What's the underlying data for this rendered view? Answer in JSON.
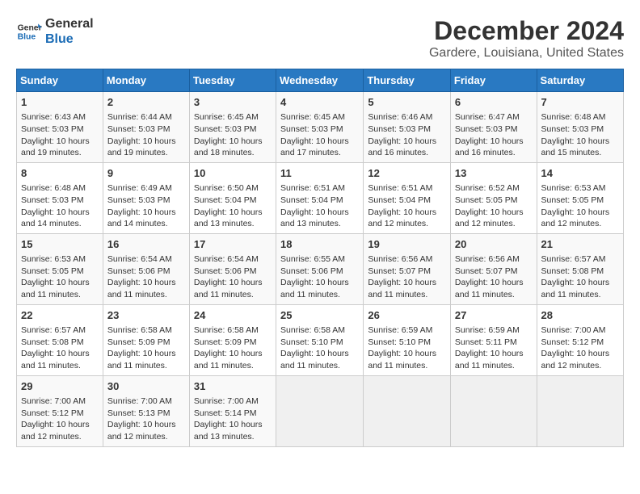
{
  "logo": {
    "line1": "General",
    "line2": "Blue"
  },
  "title": "December 2024",
  "subtitle": "Gardere, Louisiana, United States",
  "days_of_week": [
    "Sunday",
    "Monday",
    "Tuesday",
    "Wednesday",
    "Thursday",
    "Friday",
    "Saturday"
  ],
  "weeks": [
    [
      {
        "day": "1",
        "info": "Sunrise: 6:43 AM\nSunset: 5:03 PM\nDaylight: 10 hours\nand 19 minutes."
      },
      {
        "day": "2",
        "info": "Sunrise: 6:44 AM\nSunset: 5:03 PM\nDaylight: 10 hours\nand 19 minutes."
      },
      {
        "day": "3",
        "info": "Sunrise: 6:45 AM\nSunset: 5:03 PM\nDaylight: 10 hours\nand 18 minutes."
      },
      {
        "day": "4",
        "info": "Sunrise: 6:45 AM\nSunset: 5:03 PM\nDaylight: 10 hours\nand 17 minutes."
      },
      {
        "day": "5",
        "info": "Sunrise: 6:46 AM\nSunset: 5:03 PM\nDaylight: 10 hours\nand 16 minutes."
      },
      {
        "day": "6",
        "info": "Sunrise: 6:47 AM\nSunset: 5:03 PM\nDaylight: 10 hours\nand 16 minutes."
      },
      {
        "day": "7",
        "info": "Sunrise: 6:48 AM\nSunset: 5:03 PM\nDaylight: 10 hours\nand 15 minutes."
      }
    ],
    [
      {
        "day": "8",
        "info": "Sunrise: 6:48 AM\nSunset: 5:03 PM\nDaylight: 10 hours\nand 14 minutes."
      },
      {
        "day": "9",
        "info": "Sunrise: 6:49 AM\nSunset: 5:03 PM\nDaylight: 10 hours\nand 14 minutes."
      },
      {
        "day": "10",
        "info": "Sunrise: 6:50 AM\nSunset: 5:04 PM\nDaylight: 10 hours\nand 13 minutes."
      },
      {
        "day": "11",
        "info": "Sunrise: 6:51 AM\nSunset: 5:04 PM\nDaylight: 10 hours\nand 13 minutes."
      },
      {
        "day": "12",
        "info": "Sunrise: 6:51 AM\nSunset: 5:04 PM\nDaylight: 10 hours\nand 12 minutes."
      },
      {
        "day": "13",
        "info": "Sunrise: 6:52 AM\nSunset: 5:05 PM\nDaylight: 10 hours\nand 12 minutes."
      },
      {
        "day": "14",
        "info": "Sunrise: 6:53 AM\nSunset: 5:05 PM\nDaylight: 10 hours\nand 12 minutes."
      }
    ],
    [
      {
        "day": "15",
        "info": "Sunrise: 6:53 AM\nSunset: 5:05 PM\nDaylight: 10 hours\nand 11 minutes."
      },
      {
        "day": "16",
        "info": "Sunrise: 6:54 AM\nSunset: 5:06 PM\nDaylight: 10 hours\nand 11 minutes."
      },
      {
        "day": "17",
        "info": "Sunrise: 6:54 AM\nSunset: 5:06 PM\nDaylight: 10 hours\nand 11 minutes."
      },
      {
        "day": "18",
        "info": "Sunrise: 6:55 AM\nSunset: 5:06 PM\nDaylight: 10 hours\nand 11 minutes."
      },
      {
        "day": "19",
        "info": "Sunrise: 6:56 AM\nSunset: 5:07 PM\nDaylight: 10 hours\nand 11 minutes."
      },
      {
        "day": "20",
        "info": "Sunrise: 6:56 AM\nSunset: 5:07 PM\nDaylight: 10 hours\nand 11 minutes."
      },
      {
        "day": "21",
        "info": "Sunrise: 6:57 AM\nSunset: 5:08 PM\nDaylight: 10 hours\nand 11 minutes."
      }
    ],
    [
      {
        "day": "22",
        "info": "Sunrise: 6:57 AM\nSunset: 5:08 PM\nDaylight: 10 hours\nand 11 minutes."
      },
      {
        "day": "23",
        "info": "Sunrise: 6:58 AM\nSunset: 5:09 PM\nDaylight: 10 hours\nand 11 minutes."
      },
      {
        "day": "24",
        "info": "Sunrise: 6:58 AM\nSunset: 5:09 PM\nDaylight: 10 hours\nand 11 minutes."
      },
      {
        "day": "25",
        "info": "Sunrise: 6:58 AM\nSunset: 5:10 PM\nDaylight: 10 hours\nand 11 minutes."
      },
      {
        "day": "26",
        "info": "Sunrise: 6:59 AM\nSunset: 5:10 PM\nDaylight: 10 hours\nand 11 minutes."
      },
      {
        "day": "27",
        "info": "Sunrise: 6:59 AM\nSunset: 5:11 PM\nDaylight: 10 hours\nand 11 minutes."
      },
      {
        "day": "28",
        "info": "Sunrise: 7:00 AM\nSunset: 5:12 PM\nDaylight: 10 hours\nand 12 minutes."
      }
    ],
    [
      {
        "day": "29",
        "info": "Sunrise: 7:00 AM\nSunset: 5:12 PM\nDaylight: 10 hours\nand 12 minutes."
      },
      {
        "day": "30",
        "info": "Sunrise: 7:00 AM\nSunset: 5:13 PM\nDaylight: 10 hours\nand 12 minutes."
      },
      {
        "day": "31",
        "info": "Sunrise: 7:00 AM\nSunset: 5:14 PM\nDaylight: 10 hours\nand 13 minutes."
      },
      {
        "day": "",
        "info": ""
      },
      {
        "day": "",
        "info": ""
      },
      {
        "day": "",
        "info": ""
      },
      {
        "day": "",
        "info": ""
      }
    ]
  ]
}
